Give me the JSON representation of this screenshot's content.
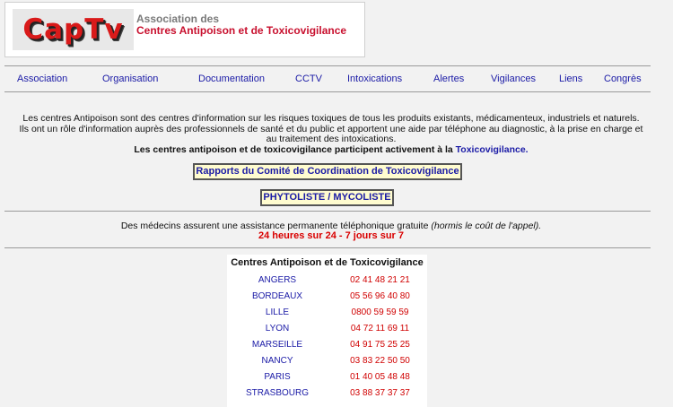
{
  "header": {
    "logo_text": "CapTv",
    "line1": "Association des",
    "line2": "Centres Antipoison et de Toxicovigilance"
  },
  "nav": {
    "items": [
      {
        "label": "Association"
      },
      {
        "label": "Organisation"
      },
      {
        "label": "Documentation"
      },
      {
        "label": "CCTV"
      },
      {
        "label": "Intoxications"
      },
      {
        "label": "Alertes"
      },
      {
        "label": "Vigilances"
      },
      {
        "label": "Liens"
      },
      {
        "label": "Congrès"
      }
    ]
  },
  "intro": {
    "line1": "Les centres Antipoison sont des centres d'information sur les risques toxiques de tous les produits existants, médicamenteux, industriels et naturels.",
    "line2": "Ils ont un rôle d'information auprès des professionnels de santé et du public et apportent une aide par téléphone au diagnostic, à la prise en charge et",
    "line3": "au traitement des intoxications.",
    "line4_text": "Les centres antipoison et de toxicovigilance participent activement à la ",
    "line4_link": "Toxicovigilance."
  },
  "buttons": {
    "rapports": "Rapports du Comité de Coordination de Toxicovigilance",
    "phytoliste": "PHYTOLISTE / MYCOLISTE"
  },
  "assistance": {
    "text": "Des médecins assurent une assistance permanente téléphonique gratuite ",
    "note": "(hormis le coût de l'appel).",
    "hours": "24 heures sur 24 - 7 jours sur 7"
  },
  "centers": {
    "title": "Centres Antipoison et de Toxicovigilance",
    "rows": [
      {
        "city": "ANGERS",
        "phone": "02 41 48 21 21"
      },
      {
        "city": "BORDEAUX",
        "phone": "05 56 96 40 80"
      },
      {
        "city": "LILLE",
        "phone": "0800 59 59 59"
      },
      {
        "city": "LYON",
        "phone": "04 72 11 69 11"
      },
      {
        "city": "MARSEILLE",
        "phone": "04 91 75 25 25"
      },
      {
        "city": "NANCY",
        "phone": "03 83 22 50 50"
      },
      {
        "city": "PARIS",
        "phone": "01 40 05 48 48"
      },
      {
        "city": "STRASBOURG",
        "phone": "03 88 37 37 37"
      }
    ]
  },
  "colors": {
    "link": "#1a1aa6",
    "red": "#d00000",
    "background": "#f2f2f2",
    "button_bg": "#fffccf"
  }
}
